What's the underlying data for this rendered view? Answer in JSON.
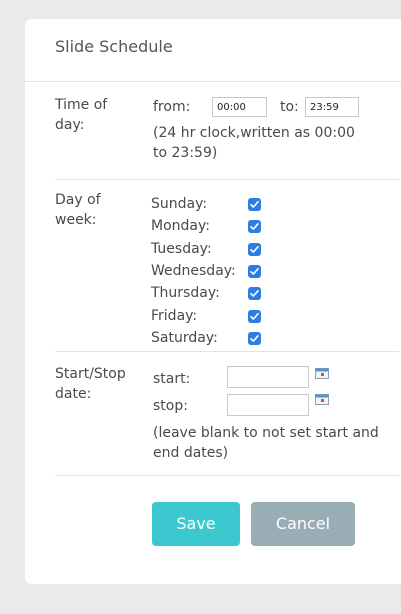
{
  "header": {
    "title": "Slide Schedule"
  },
  "time": {
    "label": "Time of day:",
    "from_label": "from:",
    "from_value": "00:00",
    "to_label": "to:",
    "to_value": "23:59",
    "note": "(24 hr clock,written as 00:00 to 23:59)"
  },
  "days": {
    "label": "Day of week:",
    "items": [
      {
        "name": "Sunday:",
        "checked": true
      },
      {
        "name": "Monday:",
        "checked": true
      },
      {
        "name": "Tuesday:",
        "checked": true
      },
      {
        "name": "Wednesday:",
        "checked": true
      },
      {
        "name": "Thursday:",
        "checked": true
      },
      {
        "name": "Friday:",
        "checked": true
      },
      {
        "name": "Saturday:",
        "checked": true
      }
    ]
  },
  "dates": {
    "label": "Start/Stop date:",
    "start_label": "start:",
    "start_value": "",
    "stop_label": "stop:",
    "stop_value": "",
    "note": "(leave blank to not set start and end dates)"
  },
  "buttons": {
    "save": "Save",
    "cancel": "Cancel"
  },
  "colors": {
    "accent": "#3cc8cf",
    "cancel": "#9aacb4",
    "checkbox": "#2f7de1"
  }
}
